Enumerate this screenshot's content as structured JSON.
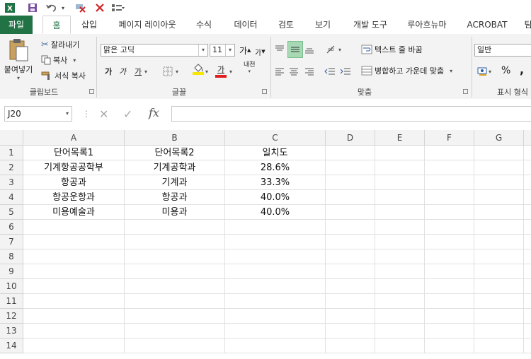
{
  "quick_access": {
    "excel_icon": "excel-logo-icon",
    "save_icon": "save-icon",
    "undo_icon": "undo-icon",
    "redo_icon": "redo-icon"
  },
  "tabs": [
    {
      "label": "파일"
    },
    {
      "label": "홈"
    },
    {
      "label": "삽입"
    },
    {
      "label": "페이지 레이아웃"
    },
    {
      "label": "수식"
    },
    {
      "label": "데이터"
    },
    {
      "label": "검토"
    },
    {
      "label": "보기"
    },
    {
      "label": "개발 도구"
    },
    {
      "label": "루아흐뉴마"
    },
    {
      "label": "ACROBAT"
    },
    {
      "label": "팀"
    }
  ],
  "ribbon": {
    "clipboard": {
      "paste": "붙여넣기",
      "cut": "잘라내기",
      "copy": "복사",
      "format_painter": "서식 복사",
      "label": "클립보드"
    },
    "font": {
      "font_name": "맑은 고딕",
      "font_size": "11",
      "grow": "가",
      "shrink": "가",
      "bold": "가",
      "italic": "가",
      "underline": "가",
      "font_color": "가",
      "phonetic": "내천",
      "label": "글꼴"
    },
    "alignment": {
      "wrap_text": "텍스트 줄 바꿈",
      "merge_center": "병합하고 가운데 맞춤",
      "label": "맞춤"
    },
    "number": {
      "format": "일반",
      "percent": "%",
      "comma": ",",
      "label": "표시 형식"
    }
  },
  "formula_bar": {
    "name_box": "J20",
    "cancel": "✕",
    "enter": "✓",
    "fx": "fx",
    "content": ""
  },
  "columns": [
    "A",
    "B",
    "C",
    "D",
    "E",
    "F",
    "G"
  ],
  "rows": [
    "1",
    "2",
    "3",
    "4",
    "5",
    "6",
    "7",
    "8",
    "9",
    "10",
    "11",
    "12",
    "13",
    "14"
  ],
  "cells": [
    [
      "단어목록1",
      "단어목록2",
      "일치도"
    ],
    [
      "기계항공공학부",
      "기계공학과",
      "28.6%"
    ],
    [
      "항공과",
      "기계과",
      "33.3%"
    ],
    [
      "항공운항과",
      "항공과",
      "40.0%"
    ],
    [
      "미용예술과",
      "미용과",
      "40.0%"
    ]
  ]
}
